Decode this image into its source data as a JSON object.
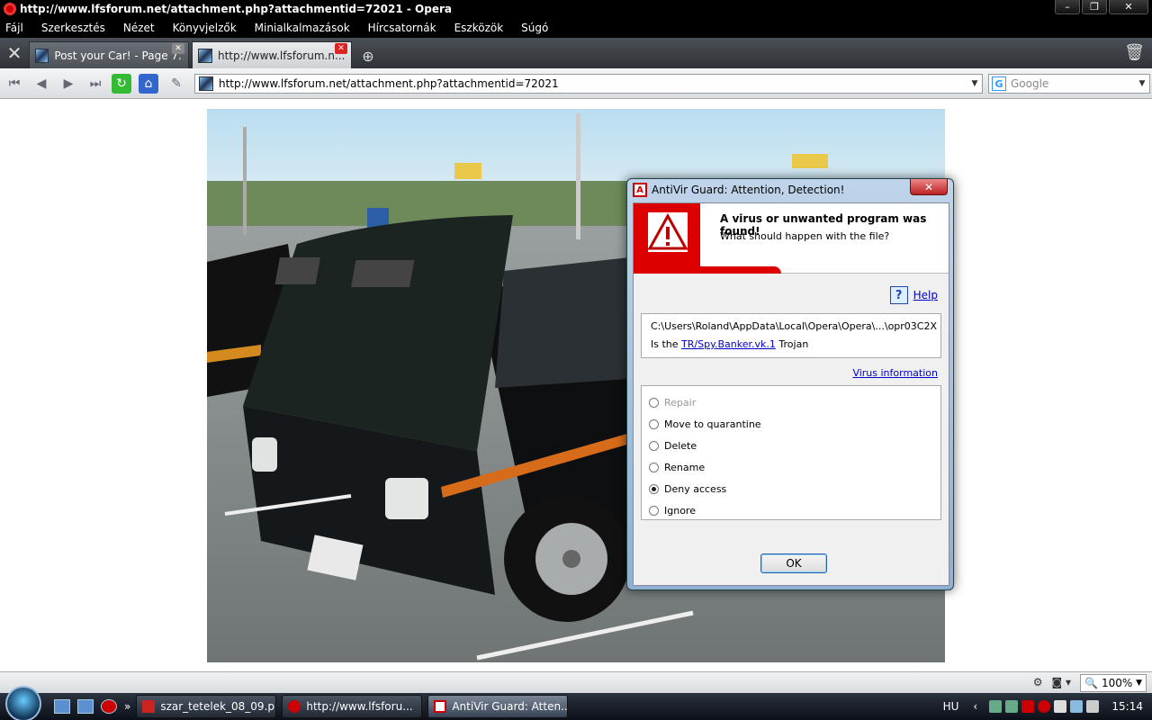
{
  "window": {
    "title": "http://www.lfsforum.net/attachment.php?attachmentid=72021 - Opera",
    "minimize": "–",
    "restore": "❐",
    "close": "✕"
  },
  "menu": [
    "Fájl",
    "Szerkesztés",
    "Nézet",
    "Könyvjelzők",
    "Minialkalmazások",
    "Hírcsatornák",
    "Eszközök",
    "Súgó"
  ],
  "tabs": [
    {
      "title": "Post your Car! - Page 7...",
      "active": false
    },
    {
      "title": "http://www.lfsforum.n...",
      "active": true
    }
  ],
  "address": {
    "url": "http://www.lfsforum.net/attachment.php?attachmentid=72021"
  },
  "search": {
    "placeholder": "Google"
  },
  "status": {
    "zoom": "100%"
  },
  "dialog": {
    "title": "AntiVir Guard: Attention, Detection!",
    "headline": "A virus or unwanted program was found!",
    "question": "What should happen with the file?",
    "help": "Help",
    "file_path": "C:\\Users\\Roland\\AppData\\Local\\Opera\\Opera\\...\\opr03C2X",
    "detect_prefix": "Is the",
    "detect_name": "TR/Spy.Banker.vk.1",
    "detect_suffix": "Trojan",
    "virus_info": "Virus information",
    "options": [
      {
        "label": "Repair",
        "checked": false,
        "disabled": true
      },
      {
        "label": "Move to quarantine",
        "checked": false,
        "disabled": false
      },
      {
        "label": "Delete",
        "checked": false,
        "disabled": false
      },
      {
        "label": "Rename",
        "checked": false,
        "disabled": false
      },
      {
        "label": "Deny access",
        "checked": true,
        "disabled": false
      },
      {
        "label": "Ignore",
        "checked": false,
        "disabled": false
      }
    ],
    "ok": "OK"
  },
  "taskbar": {
    "more": "»",
    "tasks": [
      {
        "label": "szar_tetelek_08_09.p...",
        "active": false
      },
      {
        "label": "http://www.lfsforu...",
        "active": false
      },
      {
        "label": "AntiVir Guard: Atten...",
        "active": true
      }
    ],
    "lang": "HU",
    "clock": "15:14"
  },
  "colors": {
    "antivir_red": "#d00000",
    "link": "#0000cc"
  }
}
